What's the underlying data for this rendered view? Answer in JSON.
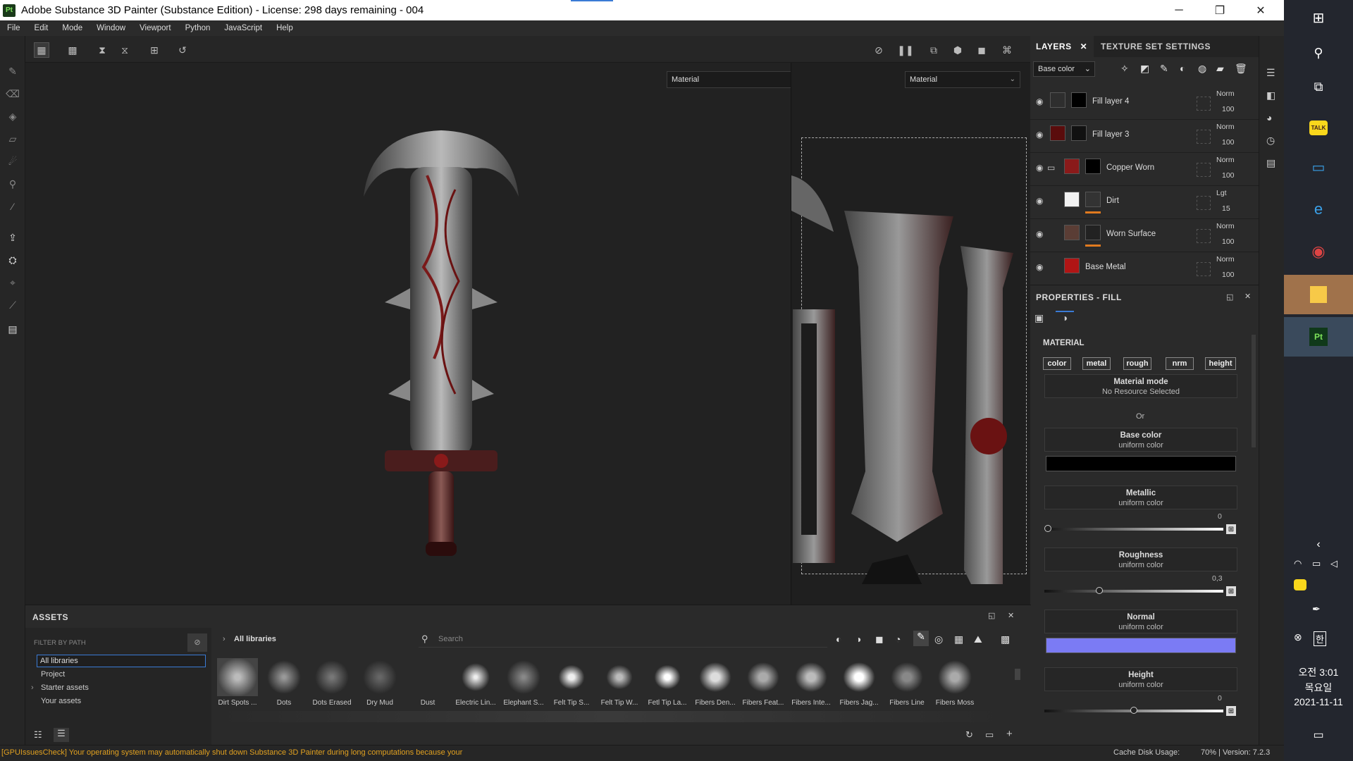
{
  "app": {
    "logo": "Pt",
    "title": "Adobe Substance 3D Painter (Substance Edition) - License: 298 days remaining - 004",
    "window_controls": [
      "─",
      "❐",
      "✕"
    ]
  },
  "menu": [
    "File",
    "Edit",
    "Mode",
    "Window",
    "Viewport",
    "Python",
    "JavaScript",
    "Help"
  ],
  "viewports": {
    "left_material": "Material",
    "right_material": "Material"
  },
  "layers_panel": {
    "tab_layers": "LAYERS",
    "tab_texture": "TEXTURE SET SETTINGS",
    "channel": "Base color",
    "layers": [
      {
        "name": "Fill layer 4",
        "blend": "Norm",
        "opacity": "100"
      },
      {
        "name": "Fill layer 3",
        "blend": "Norm",
        "opacity": "100"
      },
      {
        "name": "Copper Worn",
        "blend": "Norm",
        "opacity": "100"
      },
      {
        "name": "Dirt",
        "blend": "Lgt",
        "opacity": "15"
      },
      {
        "name": "Worn Surface",
        "blend": "Norm",
        "opacity": "100"
      },
      {
        "name": "Base Metal",
        "blend": "Norm",
        "opacity": "100"
      }
    ]
  },
  "properties": {
    "title": "PROPERTIES - FILL",
    "section": "MATERIAL",
    "channels": [
      "color",
      "metal",
      "rough",
      "nrm",
      "height"
    ],
    "material_mode_label": "Material mode",
    "material_mode_value": "No Resource Selected",
    "or_label": "Or",
    "base_color_label": "Base color",
    "base_color_sub": "uniform color",
    "metallic_label": "Metallic",
    "metallic_sub": "uniform color",
    "metallic_value": 0,
    "metallic_text": "0",
    "roughness_label": "Roughness",
    "roughness_sub": "uniform color",
    "roughness_value": 0.3,
    "roughness_text": "0,3",
    "normal_label": "Normal",
    "normal_sub": "uniform color",
    "normal_color": "#7b7bf4",
    "height_label": "Height",
    "height_sub": "uniform color",
    "height_value": 0,
    "height_text": "0"
  },
  "assets": {
    "title": "ASSETS",
    "filter_label": "FILTER BY PATH",
    "tree": [
      "All libraries",
      "Project",
      "Starter assets",
      "Your assets"
    ],
    "breadcrumb": "All libraries",
    "search_placeholder": "Search",
    "items": [
      "Dirt Spots ...",
      "Dots",
      "Dots Erased",
      "Dry Mud",
      "Dust",
      "Electric Lin...",
      "Elephant S...",
      "Felt Tip S...",
      "Felt Tip W...",
      "Fetl Tip La...",
      "Fibers Den...",
      "Fibers Feat...",
      "Fibers Inte...",
      "Fibers Jag...",
      "Fibers Line",
      "Fibers Moss"
    ]
  },
  "status": {
    "warning": "[GPUIssuesCheck] Your operating system may automatically shut down Substance 3D Painter during long computations because your",
    "cache_label": "Cache Disk Usage:",
    "cache_value": "70% | Version: 7.2.3"
  },
  "taskbar": {
    "talk_label": "TALK",
    "app_label": "Pt",
    "ime": "한",
    "time": "오전 3:01",
    "day": "목요일",
    "date": "2021-11-11"
  }
}
